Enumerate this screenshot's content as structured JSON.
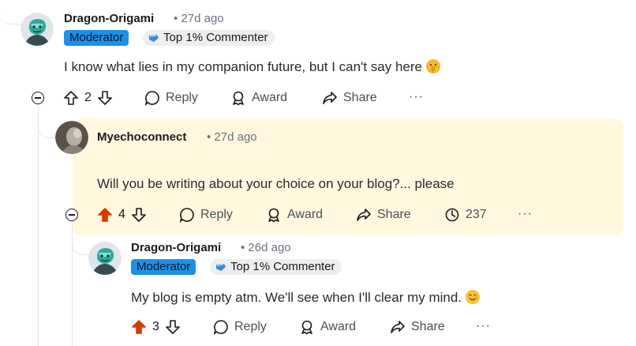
{
  "comments": [
    {
      "username": "Dragon-Origami",
      "time": "27d ago",
      "badges": {
        "moderator": "Moderator",
        "top": "Top 1% Commenter"
      },
      "text": "I know what lies in my companion future, but I can't say here",
      "emoji": "shushing-face-emoji",
      "votes": "2",
      "upvoted": false,
      "actions": {
        "reply": "Reply",
        "award": "Award",
        "share": "Share",
        "more": "···"
      }
    },
    {
      "username": "Myechoconnect",
      "time": "27d ago",
      "text": "Will you be writing about your choice on your blog?... please",
      "votes": "4",
      "upvoted": true,
      "views": "237",
      "actions": {
        "reply": "Reply",
        "award": "Award",
        "share": "Share",
        "more": "···"
      }
    },
    {
      "username": "Dragon-Origami",
      "time": "26d ago",
      "badges": {
        "moderator": "Moderator",
        "top": "Top 1% Commenter"
      },
      "text": "My blog is empty atm. We'll see when I'll clear my mind.",
      "emoji": "smiling-face-emoji",
      "votes": "3",
      "upvoted": true,
      "actions": {
        "reply": "Reply",
        "award": "Award",
        "share": "Share",
        "more": "···"
      }
    }
  ],
  "colors": {
    "upvote": "#d93a00",
    "moderator_badge": "#1e90e6",
    "highlight": "#fff8df"
  }
}
